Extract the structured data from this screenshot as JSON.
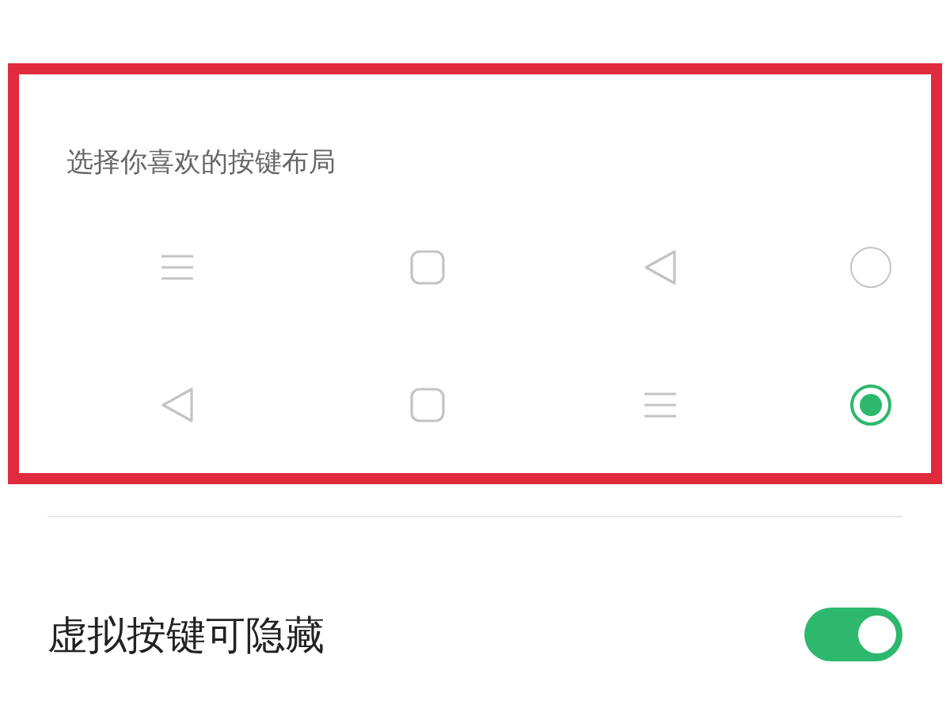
{
  "heading": "选择你喜欢的按键布局",
  "layouts": [
    {
      "keys": [
        {
          "kind": "menu"
        },
        {
          "kind": "home"
        },
        {
          "kind": "back"
        }
      ],
      "selected": false
    },
    {
      "keys": [
        {
          "kind": "back"
        },
        {
          "kind": "home"
        },
        {
          "kind": "menu"
        }
      ],
      "selected": true
    }
  ],
  "settings": [
    {
      "label": "虚拟按键可隐藏",
      "on": true
    }
  ]
}
